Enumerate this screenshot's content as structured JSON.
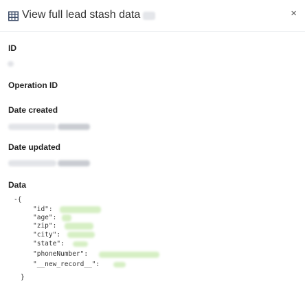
{
  "modal": {
    "title": "View full lead stash data",
    "close_glyph": "×",
    "icon": "table-icon"
  },
  "fields": {
    "id_label": "ID",
    "operation_id_label": "Operation ID",
    "date_created_label": "Date created",
    "date_updated_label": "Date updated",
    "data_label": "Data"
  },
  "json_view": {
    "open_toggle": "-{",
    "close_brace": "}",
    "keys": [
      "\"id\":",
      "\"age\":",
      "\"zip\":",
      "\"city\":",
      "\"state\":",
      "\"phoneNumber\":",
      "\"__new_record__\":"
    ]
  },
  "colors": {
    "accent_blue": "#3b5bdb",
    "redacted_grey": "#e2e4e8",
    "redacted_green": "#d6efc4"
  }
}
